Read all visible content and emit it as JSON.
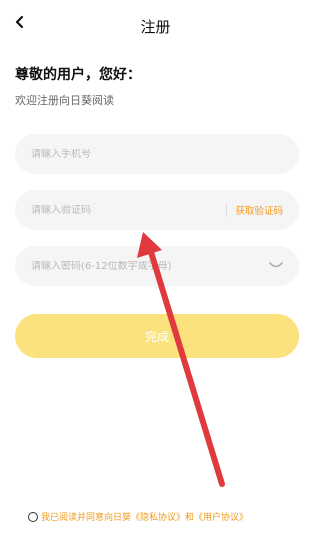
{
  "header": {
    "back_icon": "chevron-left-icon",
    "title": "注册"
  },
  "intro": {
    "greeting": "尊敬的用户，您好：",
    "subtitle": "欢迎注册向日葵阅读"
  },
  "form": {
    "phone_placeholder": "请输入手机号",
    "code_placeholder": "请输入验证码",
    "get_code_label": "获取验证码",
    "password_placeholder": "请输入密码(6-12位数字或字母)",
    "password_toggle_icon": "eye-closed-icon",
    "submit_label": "完成"
  },
  "agreement": {
    "text": "我已阅读并同意向日葵《隐私协议》和《用户协议》",
    "checked": false
  },
  "colors": {
    "accent": "#f29a1a",
    "button": "#fbe27c",
    "field_bg": "#f5f5f5",
    "annotation_arrow": "#e0393e"
  }
}
